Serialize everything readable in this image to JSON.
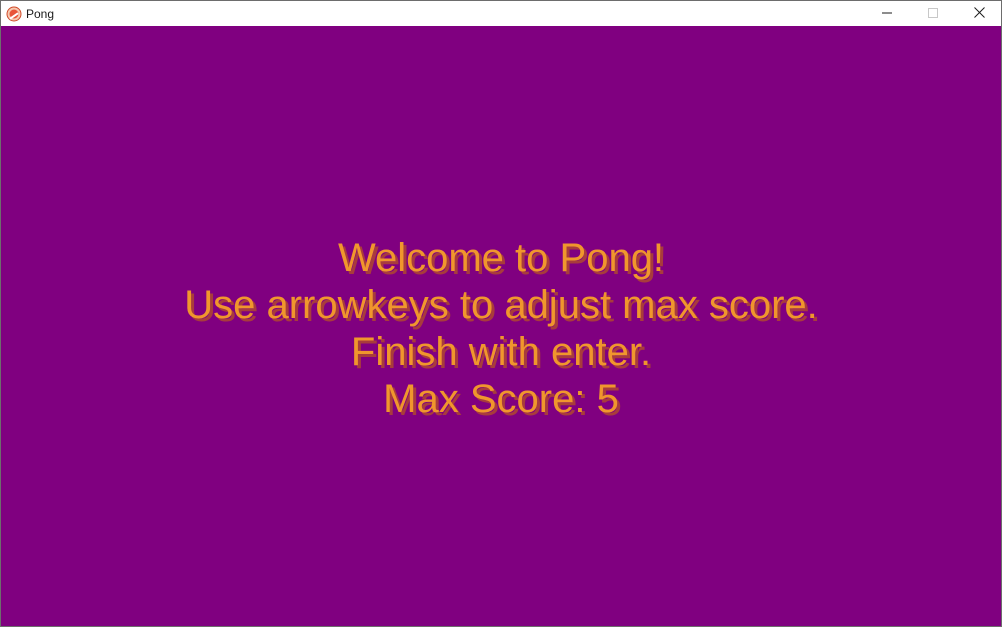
{
  "window": {
    "title": "Pong",
    "app_icon": "pong-app-icon",
    "controls": {
      "minimize_icon": "minimize-icon",
      "maximize_icon": "maximize-icon",
      "close_icon": "close-icon"
    }
  },
  "game": {
    "background_color": "#800080",
    "text_color": "#f0962d",
    "shadow_color": "#a83c3c",
    "menu": {
      "welcome": "Welcome to Pong!",
      "instruction": "Use arrowkeys to adjust max score.",
      "finish": "Finish with enter.",
      "max_score_label": "Max Score: 5"
    }
  }
}
